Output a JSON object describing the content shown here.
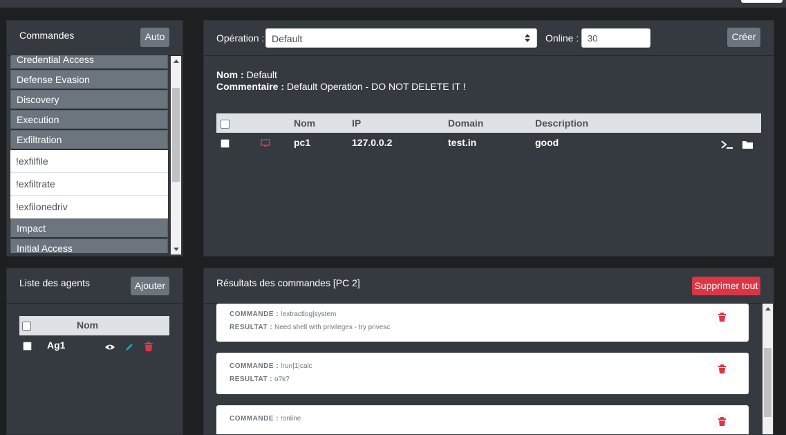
{
  "commands_panel": {
    "title": "Commandes",
    "auto_label": "Auto",
    "items": [
      {
        "label": "Credential Access",
        "type": "category"
      },
      {
        "label": "Defense Evasion",
        "type": "category"
      },
      {
        "label": "Discovery",
        "type": "category"
      },
      {
        "label": "Execution",
        "type": "category"
      },
      {
        "label": "Exfiltration",
        "type": "category"
      },
      {
        "label": "!exfilfile",
        "type": "command"
      },
      {
        "label": "!exfiltrate",
        "type": "command"
      },
      {
        "label": "!exfilonedriv",
        "type": "command"
      },
      {
        "label": "Impact",
        "type": "category"
      },
      {
        "label": "Initial Access",
        "type": "category"
      }
    ]
  },
  "operation_panel": {
    "operation_label": "Opération :",
    "operation_value": "Default",
    "online_label": "Online :",
    "online_value": "30",
    "create_label": "Créer",
    "nom_label": "Nom :",
    "nom_value": "Default",
    "comment_label": "Commentaire :",
    "comment_value": "Default Operation - DO NOT DELETE IT !",
    "table": {
      "headers": [
        "Nom",
        "IP",
        "Domain",
        "Description"
      ],
      "rows": [
        {
          "nom": "pc1",
          "ip": "127.0.0.2",
          "domain": "test.in",
          "description": "good"
        }
      ]
    }
  },
  "agents_panel": {
    "title": "Liste des agents",
    "add_label": "Ajouter",
    "header": "Nom",
    "agents": [
      {
        "name": "Ag1"
      }
    ]
  },
  "results_panel": {
    "title": "Résultats des commandes [PC 2]",
    "delete_all_label": "Supprimer tout",
    "command_label": "COMMANDE :",
    "result_label": "RESULTAT :",
    "results": [
      {
        "command": "!extractlog|system",
        "result": "Need shell with privileges - try privesc"
      },
      {
        "command": "!run|1|calc",
        "result": "o?k?"
      },
      {
        "command": "!online",
        "result": ""
      }
    ]
  },
  "colors": {
    "accent_red": "#dc3545",
    "panel_bg": "#343a40",
    "button_grey": "#6c757d",
    "page_bg": "#1e1f20"
  }
}
